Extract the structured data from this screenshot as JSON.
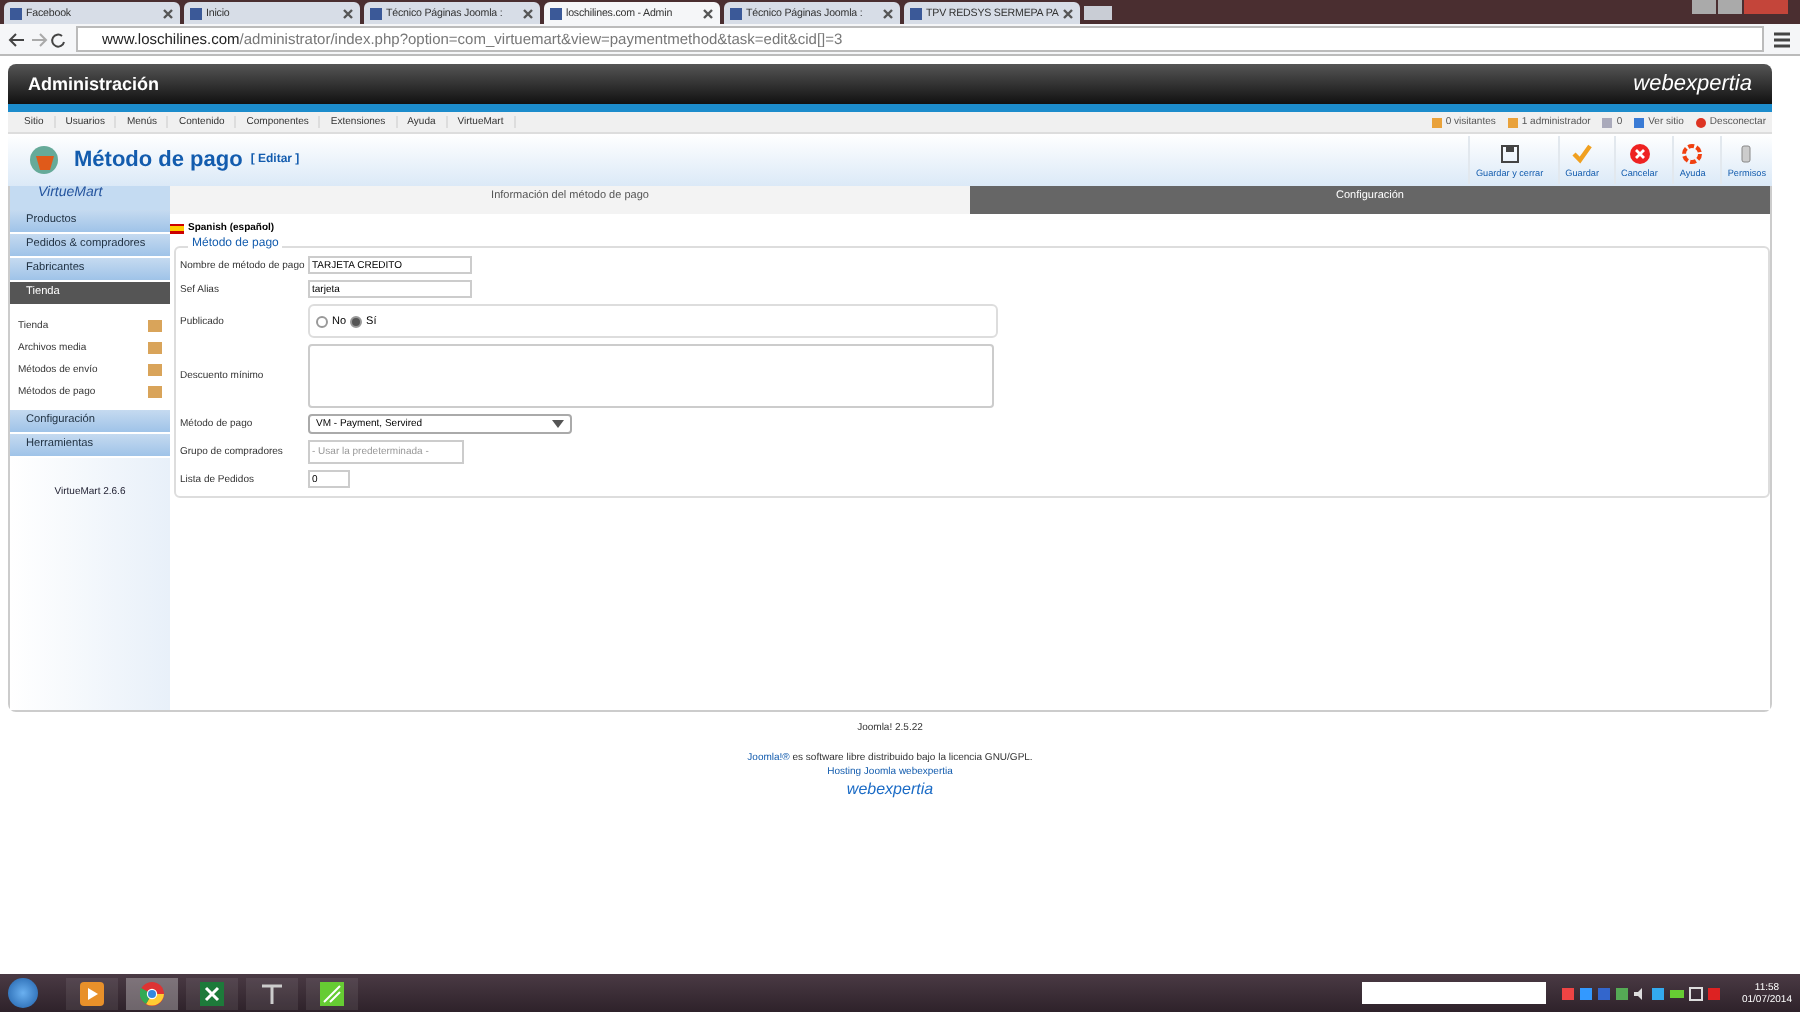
{
  "browser": {
    "tabs": [
      {
        "label": "Facebook",
        "selected": false
      },
      {
        "label": "Inicio",
        "selected": false
      },
      {
        "label": "Técnico Páginas Joomla :",
        "selected": false
      },
      {
        "label": "loschilines.com - Admin",
        "selected": true
      },
      {
        "label": "Técnico Páginas Joomla :",
        "selected": false
      },
      {
        "label": "TPV REDSYS SERMEPA PA",
        "selected": false
      }
    ],
    "url_host": "www.loschilines.com",
    "url_path": "/administrator/index.php?option=com_virtuemart&view=paymentmethod&task=edit&cid[]=3"
  },
  "header": {
    "title": "Administración",
    "brand": "webexpertia"
  },
  "menu": [
    "Sitio",
    "Usuarios",
    "Menús",
    "Contenido",
    "Componentes",
    "Extensiones",
    "Ayuda",
    "VirtueMart"
  ],
  "status": [
    "0 visitantes",
    "1 administrador",
    "0",
    "Ver sitio",
    "Desconectar"
  ],
  "page": {
    "title": "Método de pago",
    "subtitle": "[ Editar ]"
  },
  "toolbar": [
    "Guardar y cerrar",
    "Guardar",
    "Cancelar",
    "Ayuda",
    "Permisos"
  ],
  "sidebar": {
    "logo": "VirtueMart",
    "items": [
      {
        "label": "Productos",
        "selected": false
      },
      {
        "label": "Pedidos & compradores",
        "selected": false
      },
      {
        "label": "Fabricantes",
        "selected": false
      },
      {
        "label": "Tienda",
        "selected": true,
        "children": [
          "Tienda",
          "Archivos media",
          "Métodos de envío",
          "Métodos de pago"
        ]
      },
      {
        "label": "Configuración",
        "selected": false
      },
      {
        "label": "Herramientas",
        "selected": false
      }
    ],
    "version": "VirtueMart 2.6.6"
  },
  "tabs": [
    {
      "label": "Información del método de pago",
      "selected": true
    },
    {
      "label": "Configuración",
      "selected": false
    }
  ],
  "form": {
    "language": "Spanish (español)",
    "legend": "Método de pago",
    "fields": [
      {
        "kind": "text",
        "label": "Nombre de método de pago",
        "value": "TARJETA CREDITO"
      },
      {
        "kind": "text",
        "label": "Sef Alias",
        "value": "tarjeta"
      },
      {
        "kind": "radio",
        "label": "Publicado",
        "options": [
          {
            "label": "No",
            "selected": false
          },
          {
            "label": "Sí",
            "selected": true
          }
        ]
      },
      {
        "kind": "textarea",
        "label": "Descuento mínimo"
      },
      {
        "kind": "select",
        "label": "Método de pago",
        "value": "VM - Payment, Servired"
      },
      {
        "kind": "placeholder",
        "label": "Grupo de compradores",
        "placeholder": "- Usar la predeterminada -"
      },
      {
        "kind": "small",
        "label": "Lista de Pedidos",
        "value": "0"
      }
    ]
  },
  "footer": {
    "version": "Joomla! 2.5.22",
    "license_link": "Joomla!®",
    "license": "es software libre distribuido bajo la licencia GNU/GPL.",
    "hosting": "Hosting Joomla webexpertia",
    "brand": "webexpertia"
  },
  "taskbar": {
    "clock": "11:58",
    "date": "01/07/2014"
  }
}
